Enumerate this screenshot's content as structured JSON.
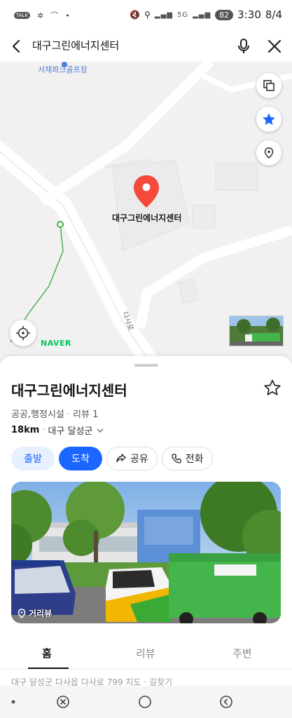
{
  "status_bar": {
    "time": "3:30",
    "date": "8/4",
    "battery": "82",
    "network": "5G",
    "left_icons": [
      "talk-icon",
      "pinwheel-icon",
      "cast-icon",
      "dot-icon"
    ]
  },
  "search": {
    "query": "대구그린에너지센터"
  },
  "map": {
    "nearby_label": "서재파크골프장",
    "marker_label": "대구그린에너지센터",
    "road_label": "다사로",
    "brand": "NAVER"
  },
  "place": {
    "name": "대구그린에너지센터",
    "category": "공공,행정시설",
    "reviews": "리뷰 1",
    "distance": "18km",
    "region": "대구 달성군"
  },
  "actions": {
    "depart": "출발",
    "arrive": "도착",
    "share": "공유",
    "call": "전화"
  },
  "photo": {
    "street_view_label": "거리뷰"
  },
  "tabs": [
    "홈",
    "리뷰",
    "주변"
  ],
  "peek_text": "대구 달성군 다사읍 다사로 799   지도 · 길찾기",
  "colors": {
    "accent": "#1a66ff",
    "pin": "#f4493b",
    "naver_green": "#03c75a"
  }
}
